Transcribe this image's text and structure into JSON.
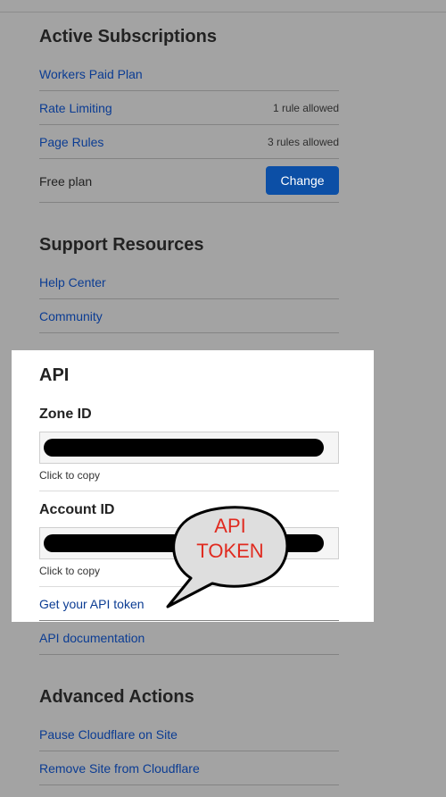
{
  "subscriptions": {
    "title": "Active Subscriptions",
    "items": [
      {
        "label": "Workers Paid Plan",
        "meta": ""
      },
      {
        "label": "Rate Limiting",
        "meta": "1 rule allowed"
      },
      {
        "label": "Page Rules",
        "meta": "3 rules allowed"
      }
    ],
    "plan": {
      "label": "Free plan",
      "button": "Change"
    }
  },
  "support": {
    "title": "Support Resources",
    "items": [
      "Help Center",
      "Community"
    ]
  },
  "api": {
    "title": "API",
    "zone_id": {
      "label": "Zone ID",
      "hint": "Click to copy"
    },
    "account_id": {
      "label": "Account ID",
      "hint": "Click to copy"
    },
    "token_link": "Get your API token",
    "docs_link": "API documentation",
    "callout_line1": "API",
    "callout_line2": "TOKEN"
  },
  "advanced": {
    "title": "Advanced Actions",
    "items": [
      "Pause Cloudflare on Site",
      "Remove Site from Cloudflare"
    ]
  },
  "colors": {
    "background": "#a3a3a3",
    "link": "#0b3c93",
    "button": "#0c4fa6",
    "callout_text": "#e02b20"
  }
}
